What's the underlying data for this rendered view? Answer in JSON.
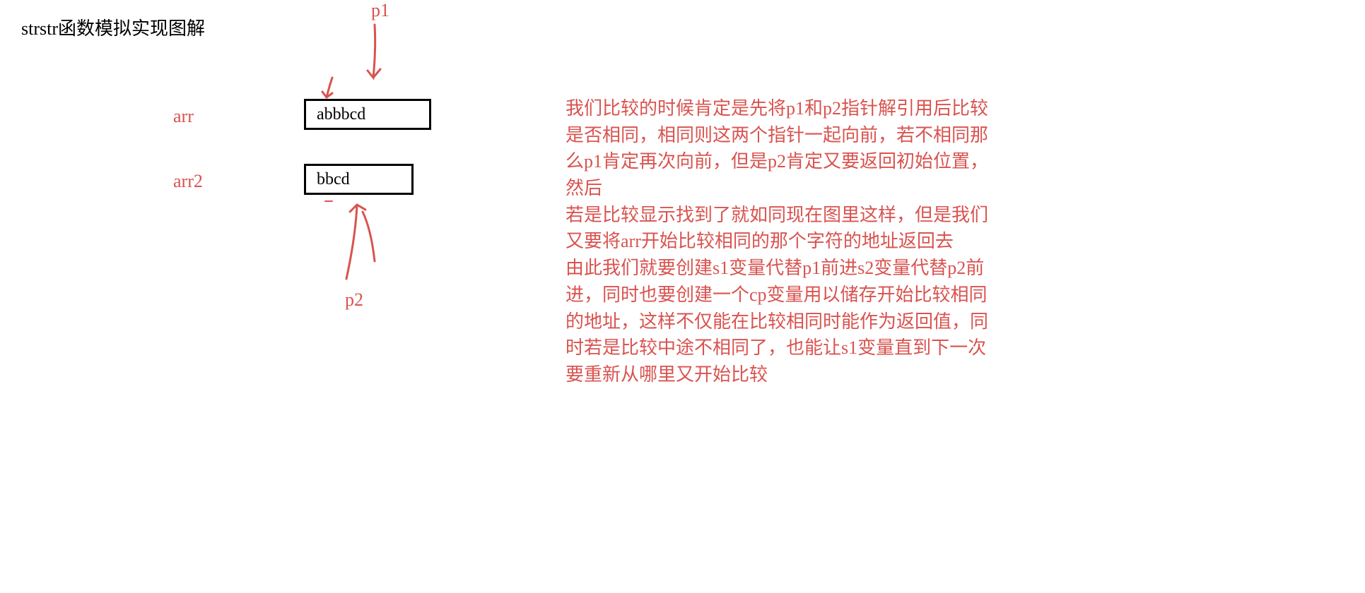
{
  "title": "strstr函数模拟实现图解",
  "labels": {
    "p1": "p1",
    "p2": "p2",
    "arr": "arr",
    "arr2": "arr2"
  },
  "boxes": {
    "arr_content": "abbbcd",
    "arr2_content": "bbcd"
  },
  "explanation": "我们比较的时候肯定是先将p1和p2指针解引用后比较是否相同，相同则这两个指针一起向前，若不相同那么p1肯定再次向前，但是p2肯定又要返回初始位置，然后\n若是比较显示找到了就如同现在图里这样，但是我们又要将arr开始比较相同的那个字符的地址返回去\n由此我们就要创建s1变量代替p1前进s2变量代替p2前进，同时也要创建一个cp变量用以储存开始比较相同的地址，这样不仅能在比较相同时能作为返回值，同时若是比较中途不相同了，也能让s1变量直到下一次要重新从哪里又开始比较",
  "colors": {
    "red": "#d9534f",
    "black": "#000000"
  }
}
